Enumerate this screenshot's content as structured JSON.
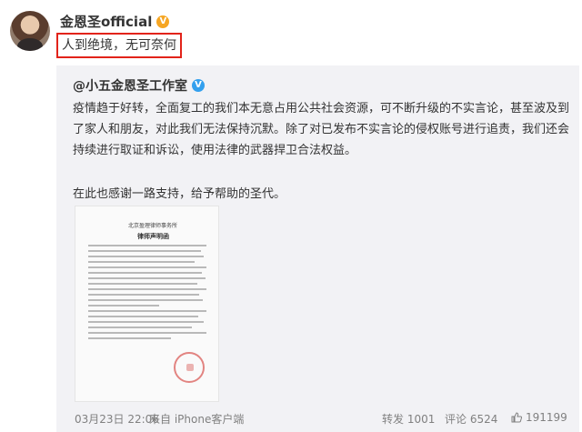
{
  "post": {
    "author": "金恩圣official",
    "verified_badge": "V",
    "text": "人到绝境，无可奈何"
  },
  "repost": {
    "author": "@小五金恩圣工作室",
    "verified_badge": "V",
    "body": "疫情趋于好转，全面复工的我们本无意占用公共社会资源，可不断升级的不实言论，甚至波及到了家人和朋友，对此我们无法保持沉默。除了对已发布不实言论的侵权账号进行追责，我们还会持续进行取证和诉讼，使用法律的武器捍卫合法权益。",
    "body2": "在此也感谢一路支持，给予帮助的圣代。",
    "image": {
      "header": "北京盈理律师事务所",
      "title": "律师声明函"
    },
    "time": "03月23日 22:06",
    "source": "来自 iPhone客户端",
    "repost_label": "转发 1001",
    "comment_label": "评论 6524",
    "likes": "191199"
  },
  "colors": {
    "highlight_border": "#e2231a",
    "repost_bg": "#f2f2f5",
    "meta_text": "#808080"
  }
}
